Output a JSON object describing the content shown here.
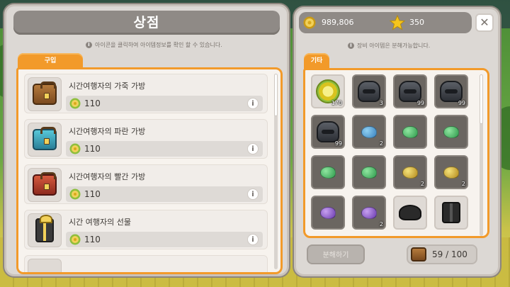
{
  "shop": {
    "title": "상점",
    "hint": "아이콘을 클릭하여 아이템정보를 확인 할 수 있습니다.",
    "tab": "구입",
    "items": [
      {
        "name": "시간여행자의 가죽 가방",
        "price": "110",
        "icon": "leather-bag-icon"
      },
      {
        "name": "시간여행자의 파란 가방",
        "price": "110",
        "icon": "blue-bag-icon"
      },
      {
        "name": "시간여행자의 빨간 가방",
        "price": "110",
        "icon": "red-bag-icon"
      },
      {
        "name": "시간 여행자의 선물",
        "price": "110",
        "icon": "gift-box-icon"
      }
    ],
    "info_label": "i"
  },
  "inventory": {
    "meso": "989,806",
    "points": "350",
    "close_label": "✕",
    "hint": "장비 아이템은 분해가능합니다.",
    "tab": "기타",
    "slots": [
      {
        "icon": "medal-icon",
        "count": "170",
        "light": true
      },
      {
        "icon": "helmet-icon",
        "count": "3"
      },
      {
        "icon": "helmet-icon",
        "count": "99"
      },
      {
        "icon": "helmet-icon",
        "count": "99"
      },
      {
        "icon": "helmet-icon",
        "count": "99"
      },
      {
        "icon": "blue-ore-icon",
        "count": "2"
      },
      {
        "icon": "green-ore-icon",
        "count": ""
      },
      {
        "icon": "green-ore-icon",
        "count": ""
      },
      {
        "icon": "green-ore-icon",
        "count": ""
      },
      {
        "icon": "green-ore-icon",
        "count": ""
      },
      {
        "icon": "gold-ore-icon",
        "count": "2"
      },
      {
        "icon": "gold-ore-icon",
        "count": "2"
      },
      {
        "icon": "purple-ore-icon",
        "count": ""
      },
      {
        "icon": "purple-ore-icon",
        "count": "2"
      },
      {
        "icon": "black-hat-icon",
        "count": ""
      },
      {
        "icon": "black-armor-icon",
        "count": ""
      }
    ],
    "disassemble_label": "분해하기",
    "capacity": "59 / 100"
  }
}
